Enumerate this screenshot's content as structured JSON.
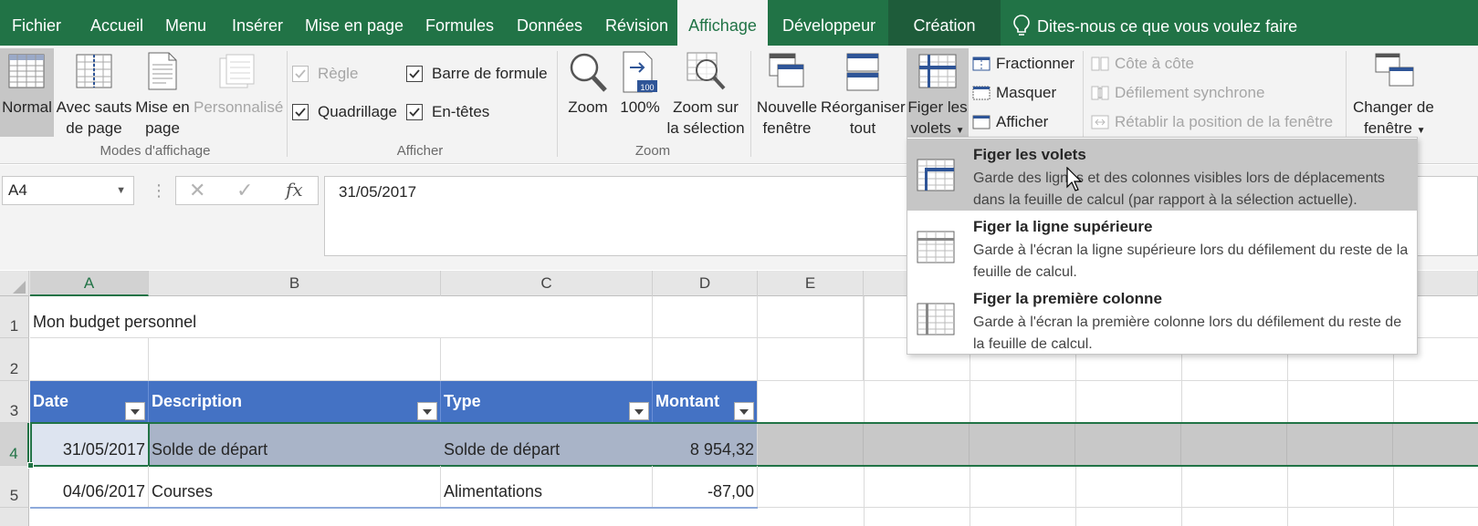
{
  "menu": {
    "tabs": [
      {
        "label": "Fichier"
      },
      {
        "label": "Accueil"
      },
      {
        "label": "Menu"
      },
      {
        "label": "Insérer"
      },
      {
        "label": "Mise en page"
      },
      {
        "label": "Formules"
      },
      {
        "label": "Données"
      },
      {
        "label": "Révision"
      },
      {
        "label": "Affichage"
      },
      {
        "label": "Développeur"
      },
      {
        "label": "Création"
      }
    ],
    "active_tab": "Affichage",
    "tell_me": "Dites-nous ce que vous voulez faire"
  },
  "ribbon": {
    "modes": {
      "normal": "Normal",
      "avec_sauts_1": "Avec sauts",
      "avec_sauts_2": "de page",
      "mise_en_page_1": "Mise en",
      "mise_en_page_2": "page",
      "personnalise": "Personnalisé",
      "group_label": "Modes d'affichage"
    },
    "afficher": {
      "regle": "Règle",
      "barre_formule": "Barre de formule",
      "quadrillage": "Quadrillage",
      "en_tetes": "En-têtes",
      "group_label": "Afficher"
    },
    "zoom": {
      "zoom": "Zoom",
      "hundred": "100%",
      "zoom_sel_1": "Zoom sur",
      "zoom_sel_2": "la sélection",
      "icon_badge": "100",
      "group_label": "Zoom"
    },
    "fenetre": {
      "nouvelle_1": "Nouvelle",
      "nouvelle_2": "fenêtre",
      "reorganiser_1": "Réorganiser",
      "reorganiser_2": "tout",
      "figer_1": "Figer les",
      "figer_2": "volets",
      "fractionner": "Fractionner",
      "masquer": "Masquer",
      "afficher": "Afficher",
      "cote_a_cote": "Côte à côte",
      "defilement_sync": "Défilement synchrone",
      "retablir": "Rétablir la position de la fenêtre",
      "changer_1": "Changer de",
      "changer_2": "fenêtre"
    }
  },
  "formula_bar": {
    "name_box": "A4",
    "formula": "31/05/2017"
  },
  "grid": {
    "columns": [
      "A",
      "B",
      "C",
      "D",
      "E"
    ],
    "rows": [
      "1",
      "2",
      "3",
      "4",
      "5"
    ],
    "title": "Mon budget personnel",
    "headers": [
      "Date",
      "Description",
      "Type",
      "Montant"
    ],
    "data": [
      [
        "31/05/2017",
        "Solde de départ",
        "Solde de départ",
        "8 954,32"
      ],
      [
        "04/06/2017",
        "Courses",
        "Alimentations",
        "-87,00"
      ]
    ]
  },
  "dropdown": {
    "items": [
      {
        "title": "Figer les volets",
        "desc": "Garde des lignes et des colonnes visibles lors de déplacements dans la feuille de calcul (par rapport à la sélection actuelle)."
      },
      {
        "title": "Figer la ligne supérieure",
        "desc": "Garde à l'écran la ligne supérieure lors du défilement du reste de la feuille de calcul."
      },
      {
        "title": "Figer la première colonne",
        "desc": "Garde à l'écran la première colonne lors du défilement du reste de la feuille de calcul."
      }
    ]
  },
  "colors": {
    "brand_green": "#217346",
    "table_header_blue": "#4472c4"
  }
}
